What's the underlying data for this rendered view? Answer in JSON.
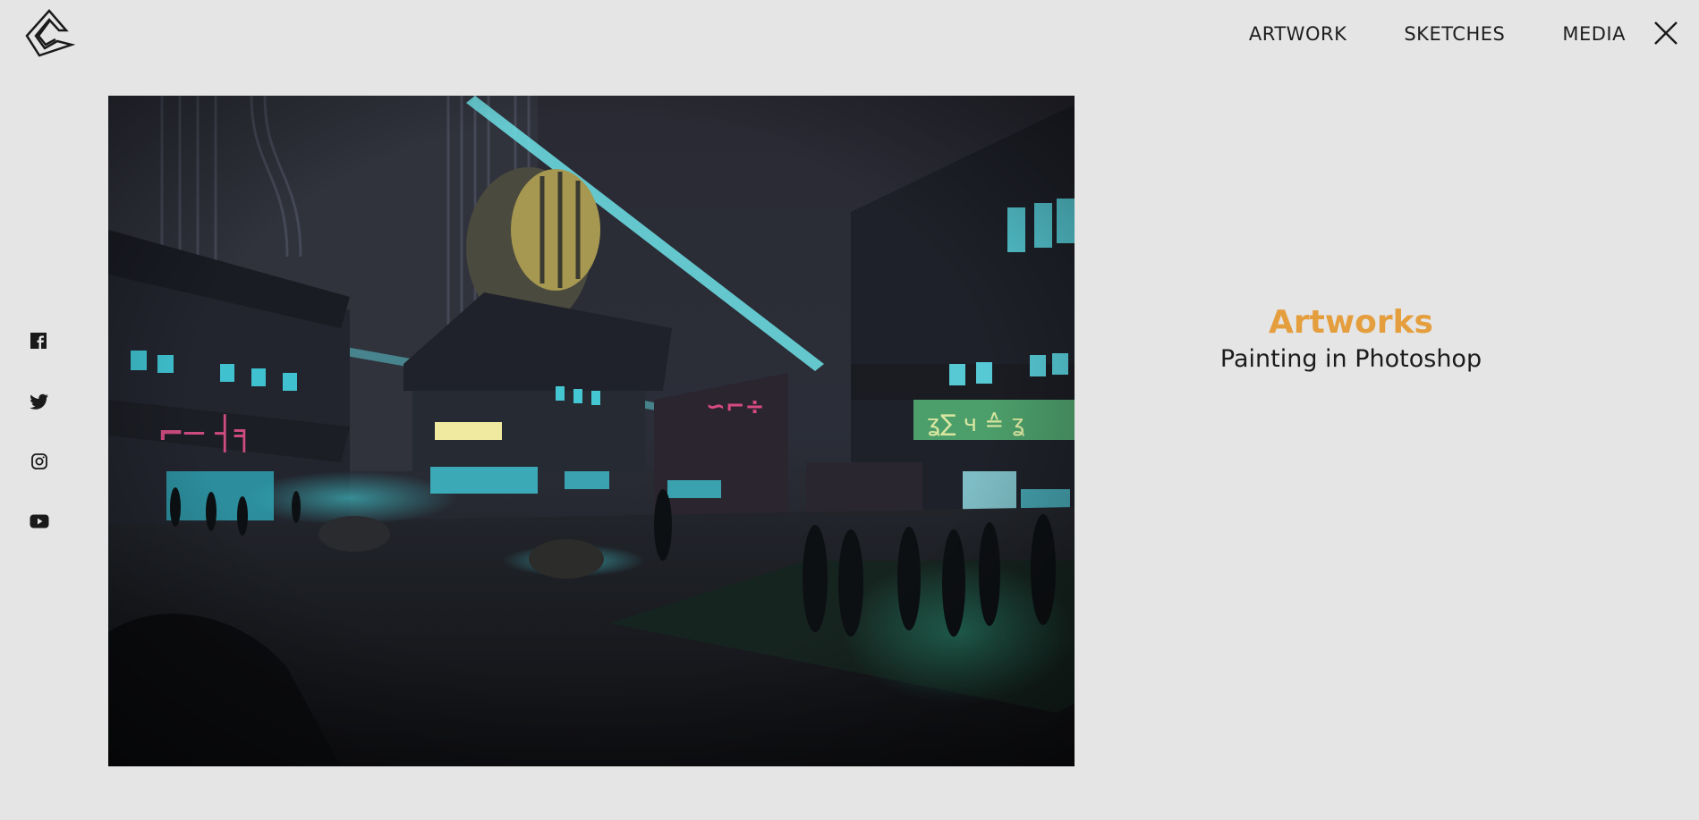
{
  "nav": {
    "items": [
      "ARTWORK",
      "SKETCHES",
      "MEDIA"
    ]
  },
  "icons": {
    "logo": "logo-icon",
    "close": "close-icon",
    "social": [
      "facebook-icon",
      "twitter-icon",
      "instagram-icon",
      "youtube-icon"
    ]
  },
  "caption": {
    "title": "Artworks",
    "subtitle": "Painting in Photoshop"
  },
  "colors": {
    "background": "#e5e5e5",
    "accent": "#e59e3e",
    "text": "#1e1e1e"
  }
}
